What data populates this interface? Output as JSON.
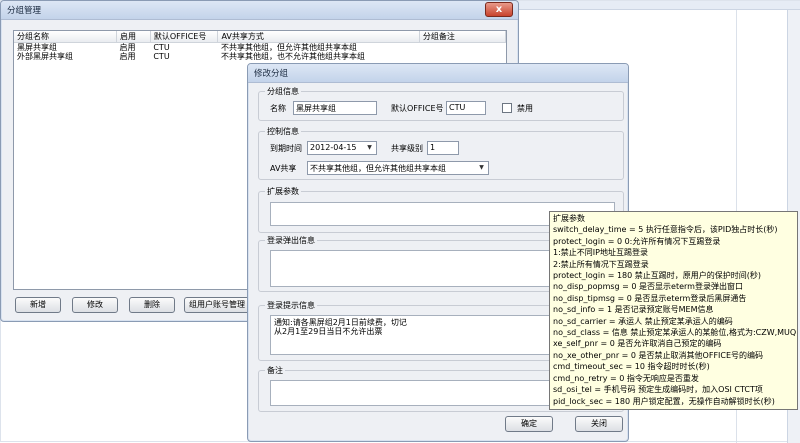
{
  "background_window": {
    "column_headers": [
      "",
      "",
      "",
      "",
      ""
    ]
  },
  "group_manager": {
    "title": "分组管理",
    "close_label": "x",
    "columns": [
      "分组名称",
      "启用",
      "默认OFFICE号",
      "AV共享方式",
      "分组备注"
    ],
    "rows": [
      [
        "黑屏共享组",
        "启用",
        "CTU",
        "不共享其他组，但允许其他组共享本组",
        ""
      ],
      [
        "外部黑屏共享组",
        "启用",
        "CTU",
        "不共享其他组，也不允许其他组共享本组",
        ""
      ]
    ],
    "buttons": {
      "add": "新增",
      "edit": "修改",
      "delete": "删除",
      "account_manage": "组用户账号管理"
    }
  },
  "edit_dialog": {
    "title": "修改分组",
    "close_label": "x",
    "group_info": {
      "title": "分组信息",
      "name_label": "名称",
      "name_value": "黑屏共享组",
      "office_label": "默认OFFICE号",
      "office_value": "CTU",
      "disable_label": "禁用",
      "disable_checked": false
    },
    "control_info": {
      "title": "控制信息",
      "expiry_label": "到期时间",
      "expiry_value": "2012-04-15",
      "share_level_label": "共享级别",
      "share_level_value": "1",
      "av_share_label": "AV共享",
      "av_share_value": "不共享其他组，但允许其他组共享本组"
    },
    "ext_params": {
      "title": "扩展参数",
      "value": ""
    },
    "login_popup": {
      "title": "登录弹出信息",
      "value": ""
    },
    "login_prompt": {
      "title": "登录提示信息",
      "lines": [
        "通知:请各黑屏组2月1日前续费，切记",
        "从2月1至29日当日不允许出票"
      ]
    },
    "remarks": {
      "title": "备注",
      "value": ""
    },
    "buttons": {
      "ok": "确定",
      "close": "关闭"
    }
  },
  "tooltip": {
    "lines": [
      "扩展参数",
      "switch_delay_time = 5 执行任意指令后，该PID独占时长(秒)",
      "protect_login = 0 0:允许所有情况下互踢登录",
      "1:禁止不同IP地址互踢登录",
      "2:禁止所有情况下互踢登录",
      "protect_login = 180 禁止互踢时，原用户的保护时间(秒)",
      "no_disp_popmsg = 0 是否显示eterm登录弹出窗口",
      "no_disp_tipmsg = 0 是否显示eterm登录后黑屏通告",
      "no_sd_info = 1 是否记录预定账号MEM信息",
      "no_sd_carrier = 承运人 禁止预定某承运人的编码",
      "no_sd_class = 信息 禁止预定某承运人的某舱位,格式为:CZW,MUQ",
      "xe_self_pnr = 0 是否允许取消自己预定的编码",
      "no_xe_other_pnr = 0 是否禁止取消其他OFFICE号的编码",
      "cmd_timeout_sec = 10 指令超时时长(秒)",
      "cmd_no_retry = 0 指令无响应是否重发",
      "sd_osi_tel = 手机号码 预定生成编码时，加入OSI CTCT项",
      "pid_lock_sec = 180 用户锁定配置，无操作自动解锁时长(秒)"
    ]
  }
}
